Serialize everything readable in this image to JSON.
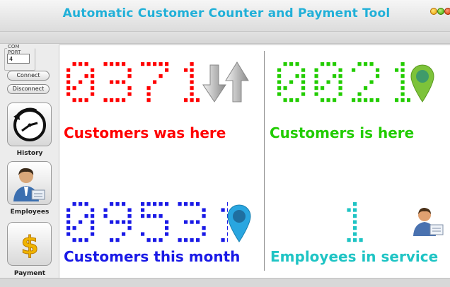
{
  "window": {
    "title": "Automatic Customer Counter and Payment Tool"
  },
  "sidebar": {
    "comport_label": "COM PORT",
    "comport_value": "4",
    "connect_label": "Connect",
    "disconnect_label": "Disconnect",
    "history_label": "History",
    "employees_label": "Employees",
    "payment_label": "Payment"
  },
  "panels": {
    "was_here": {
      "count": "0371",
      "caption": "Customers was here",
      "color": "#ff0000"
    },
    "is_here": {
      "count": "0021",
      "caption": "Customers is here",
      "color": "#22cc00"
    },
    "this_month": {
      "count": "09531",
      "caption": "Customers this month",
      "color": "#1a1ae6"
    },
    "in_service": {
      "count": "1",
      "caption": "Employees in service",
      "color": "#1fc4c4"
    }
  },
  "icons": {
    "arrows": "up-down-arrows-icon",
    "pin_green": "map-pin-icon",
    "pin_blue": "map-pin-icon",
    "employee": "employee-icon",
    "clock": "clock-icon",
    "dollar": "dollar-icon"
  }
}
